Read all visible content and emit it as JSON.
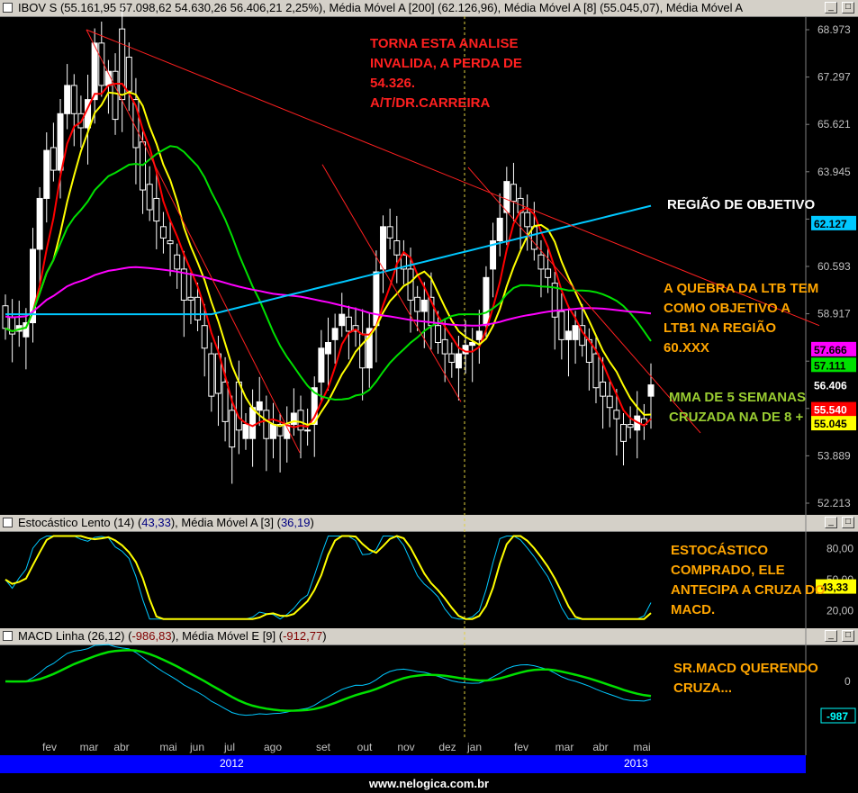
{
  "header": {
    "main": "IBOV S (55.161,95  57.098,62  54.630,26  56.406,21  2,25%), Média Móvel A [200] (62.126,96), Média Móvel A [8] (55.045,07), Média Móvel A",
    "stoch_prefix": "Estocástico Lento (14) (",
    "stoch_val": "43,33",
    "stoch_mid": "), Média Móvel A [3] (",
    "stoch_ma": "36,19",
    "stoch_suffix": ")",
    "macd_prefix": "MACD Linha (26,12) (",
    "macd_val": "-986,83",
    "macd_mid": "), Média Móvel E [9] (",
    "macd_sig": "-912,77",
    "macd_suffix": ")"
  },
  "annotations": {
    "invalid": "TORNA ESTA ANALISE\nINVALIDA, A PERDA DE\n54.326.\nA/T/DR.CARREIRA",
    "region": "REGIÃO DE OBJETIVO",
    "ltb": "A QUEBRA DA LTB TEM\nCOMO OBJETIVO A\nLTB1 NA REGIÃO\n60.XXX",
    "mma": "MMA DE 5 SEMANAS\nCRUZADA NA DE 8 +",
    "stoch": "ESTOCÁSTICO\nCOMPRADO, ELE\nANTECIPA A CRUZA DO\nMACD.",
    "macd": "SR.MACD QUERENDO\nCRUZA..."
  },
  "footer": {
    "year1": "2012",
    "year2": "2013",
    "brand": "www.nelogica.com.br"
  },
  "colors": {
    "ma200": "#00c8ff",
    "ma_magenta": "#ff00ff",
    "ma_green": "#00e000",
    "ma_yellow": "#ffff00",
    "ma_red": "#ff0000",
    "trend": "#ff2020",
    "text_red": "#ff2020",
    "text_white": "#ffffff",
    "text_orange": "#ffa500",
    "text_lime": "#9acd32"
  },
  "chart_data": [
    {
      "type": "candlestick",
      "title": "IBOV S",
      "yticks": [
        52213,
        53889,
        55565,
        57241,
        58917,
        60593,
        62269,
        63945,
        65621,
        67297,
        68973
      ],
      "ytick_labels": [
        "52.213",
        "53.889",
        "",
        "",
        "58.917",
        "60.593",
        "",
        "63.945",
        "65.621",
        "67.297",
        "68.973"
      ],
      "ylim": [
        52213,
        68973
      ],
      "x_labels": [
        "fev",
        "mar",
        "abr",
        "mai",
        "jun",
        "jul",
        "ago",
        "set",
        "out",
        "nov",
        "dez",
        "jan",
        "fev",
        "mar",
        "abr",
        "mai"
      ],
      "candles": [
        [
          59200,
          58800,
          58300,
          58100,
          58600,
          61200,
          63000,
          64800,
          64000,
          66000,
          67000,
          66000,
          65500,
          66500,
          68500,
          67000,
          67500,
          69000,
          68000,
          66500,
          65000,
          63500,
          63000,
          62000,
          61500,
          61000,
          60500,
          59500,
          59500,
          58500,
          57500,
          57500,
          56500,
          55500,
          56500,
          54500,
          54500,
          55500,
          55500,
          54500,
          55000,
          54500,
          55000,
          55500,
          54800,
          55000,
          56500,
          57500,
          58000,
          58500,
          58800,
          58500,
          58200,
          57000,
          58500,
          60500,
          62000,
          61500,
          61000,
          60500,
          59500,
          59000,
          59500,
          58500,
          58000,
          57500,
          57000,
          57500,
          57800,
          58000,
          58500,
          60500,
          61500,
          62500,
          63500,
          63000,
          62500,
          62000,
          61000,
          60500,
          60000,
          59000,
          58000,
          58000,
          58500,
          58000,
          57500,
          56500,
          56000,
          55500,
          55000,
          55000,
          54800,
          55200,
          56000
        ],
        [
          58400,
          58200,
          58500,
          58600,
          61200,
          63000,
          64700,
          64000,
          66000,
          67000,
          66000,
          65500,
          66500,
          68500,
          67000,
          67500,
          65800,
          66500,
          66800,
          64800,
          63300,
          62600,
          62200,
          61600,
          61400,
          60500,
          59400,
          59400,
          58700,
          57700,
          56000,
          56100,
          55100,
          54200,
          54800,
          55000,
          55600,
          55800,
          54500,
          55000,
          54600,
          55000,
          55400,
          54800,
          54800,
          56300,
          57700,
          57900,
          58400,
          58900,
          58300,
          58300,
          57000,
          58400,
          60400,
          62000,
          61600,
          61000,
          60500,
          59400,
          59000,
          59400,
          58500,
          57900,
          57500,
          57200,
          57500,
          57800,
          57900,
          58300,
          60200,
          61500,
          62300,
          63600,
          62900,
          62500,
          62000,
          61200,
          60500,
          60200,
          58800,
          58000,
          58300,
          58500,
          57800,
          57200,
          56300,
          56000,
          55600,
          55200,
          54400,
          54900,
          55300,
          55000,
          56400
        ]
      ],
      "series": [
        {
          "name": "Média Móvel A [200]",
          "last": "62.127"
        },
        {
          "name": "Média Móvel A [8]",
          "last": "55.045"
        }
      ],
      "price_labels": [
        "62.127",
        "57.666",
        "57.111",
        "56.406",
        "55.540",
        "55.045"
      ]
    },
    {
      "type": "line",
      "title": "Estocástico Lento (14)",
      "ylim": [
        10,
        95
      ],
      "yticks": [
        20,
        50,
        80
      ],
      "ytick_labels": [
        "20,00",
        "50,00",
        "80,00"
      ],
      "series": [
        {
          "name": "Estocástico Lento (14)",
          "last": "43,33"
        },
        {
          "name": "Média Móvel A [3]",
          "last": "36,19"
        }
      ]
    },
    {
      "type": "line",
      "title": "MACD Linha (26,12)",
      "yticks": [
        0
      ],
      "ytick_labels": [
        "0"
      ],
      "series": [
        {
          "name": "MACD Linha (26,12)",
          "last": "-987"
        },
        {
          "name": "Média Móvel E [9]",
          "last": "-912,77"
        }
      ]
    }
  ]
}
